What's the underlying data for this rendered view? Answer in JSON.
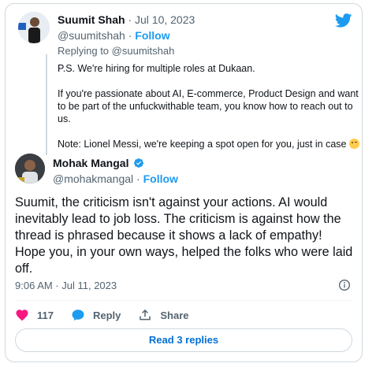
{
  "parent_tweet": {
    "name": "Suumit Shah",
    "date": "· Jul 10, 2023",
    "handle": "@suumitshah",
    "follow": "Follow",
    "replying_prefix": "Replying to",
    "replying_handle": "@suumitshah",
    "paragraphs": [
      "P.S. We're hiring for multiple roles at Dukaan.",
      "If you're passionate about AI, E-commerce, Product Design and want to be part of the unfuckwithable team, you know how to reach out to us.",
      "Note: Lionel Messi, we're keeping a spot open for you, just in case"
    ]
  },
  "main_tweet": {
    "name": "Mohak Mangal",
    "handle": "@mohakmangal",
    "follow": "Follow",
    "text": "Suumit, the criticism isn't against your actions. AI would inevitably lead to job loss. The criticism is against how the thread is phrased because it shows a lack of empathy! Hope you, in your own ways, helped the folks who were laid off.",
    "timestamp": "9:06 AM · Jul 11, 2023",
    "likes": "117",
    "reply_label": "Reply",
    "share_label": "Share",
    "read_replies": "Read 3 replies"
  },
  "colors": {
    "accent": "#1d9bf0",
    "like": "#f91880",
    "link_button": "#006fd6"
  },
  "icons": [
    "twitter-bird-icon",
    "verified-badge-icon",
    "heart-icon",
    "reply-icon",
    "share-icon",
    "info-icon"
  ]
}
